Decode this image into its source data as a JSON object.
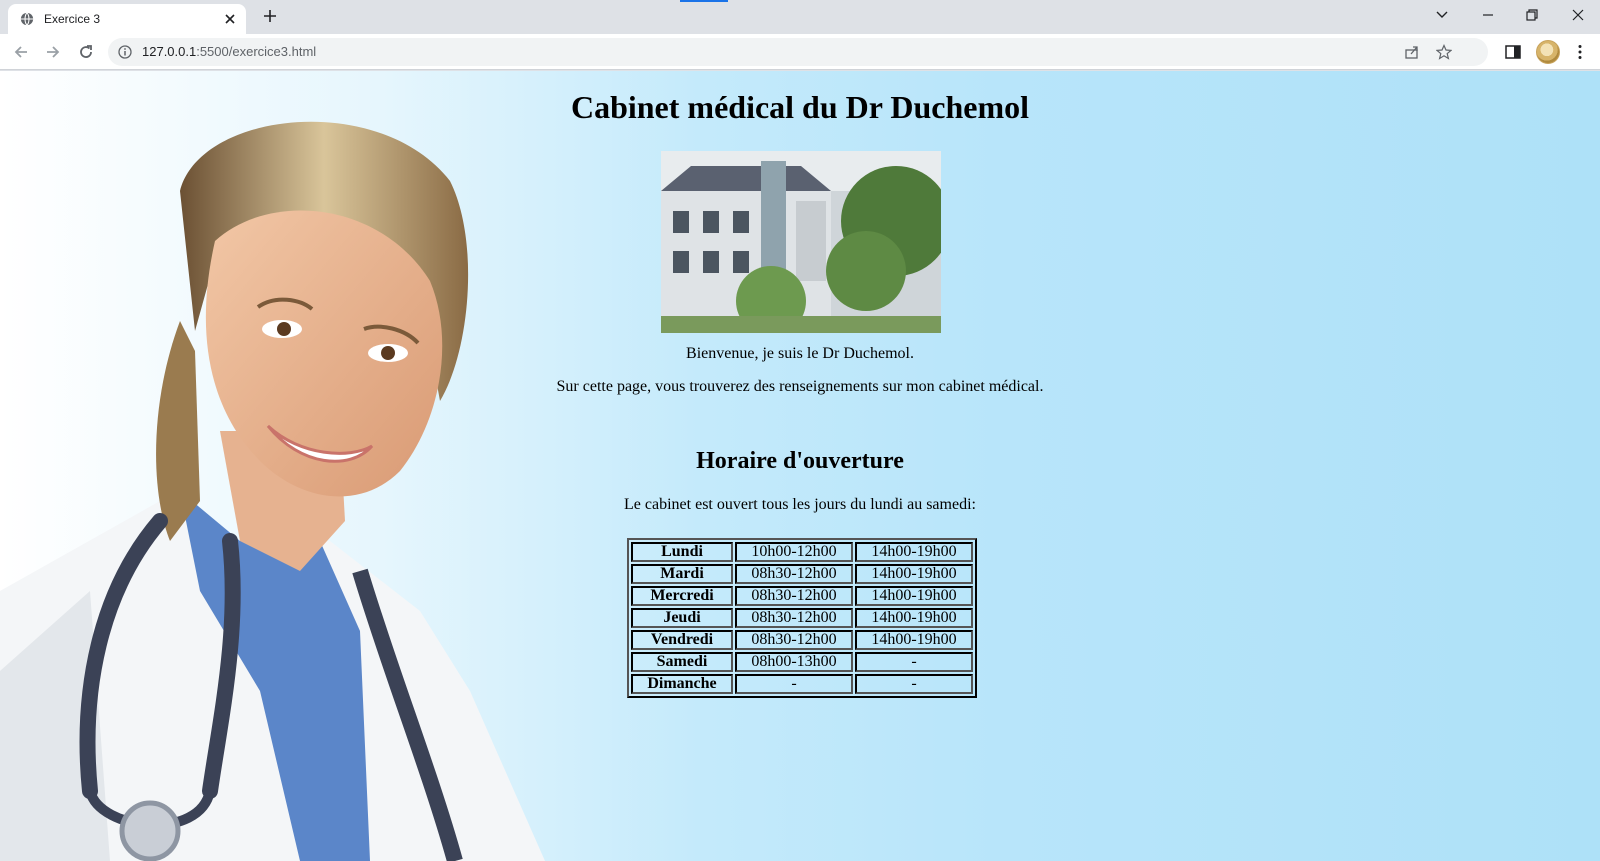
{
  "browser": {
    "tab_title": "Exercice 3",
    "url_host": "127.0.0.1",
    "url_rest": ":5500/exercice3.html"
  },
  "page": {
    "title": "Cabinet médical du Dr Duchemol",
    "welcome": "Bienvenue, je suis le Dr Duchemol.",
    "intro": "Sur cette page, vous trouverez des renseignements sur mon cabinet médical.",
    "hours_heading": "Horaire d'ouverture",
    "hours_intro": "Le cabinet est ouvert tous les jours du lundi au samedi:",
    "schedule": [
      {
        "day": "Lundi",
        "morning": "10h00-12h00",
        "afternoon": "14h00-19h00"
      },
      {
        "day": "Mardi",
        "morning": "08h30-12h00",
        "afternoon": "14h00-19h00"
      },
      {
        "day": "Mercredi",
        "morning": "08h30-12h00",
        "afternoon": "14h00-19h00"
      },
      {
        "day": "Jeudi",
        "morning": "08h30-12h00",
        "afternoon": "14h00-19h00"
      },
      {
        "day": "Vendredi",
        "morning": "08h30-12h00",
        "afternoon": "14h00-19h00"
      },
      {
        "day": "Samedi",
        "morning": "08h00-13h00",
        "afternoon": "-"
      },
      {
        "day": "Dimanche",
        "morning": "-",
        "afternoon": "-"
      }
    ]
  },
  "colors": {
    "accent": "#1a73e8",
    "page_bg": "#aee1f8"
  },
  "icons": [
    "globe-icon",
    "close-icon",
    "plus-icon",
    "back-arrow-icon",
    "forward-arrow-icon",
    "reload-icon",
    "info-icon",
    "share-icon",
    "star-icon",
    "side-panel-icon",
    "menu-dots-icon"
  ]
}
